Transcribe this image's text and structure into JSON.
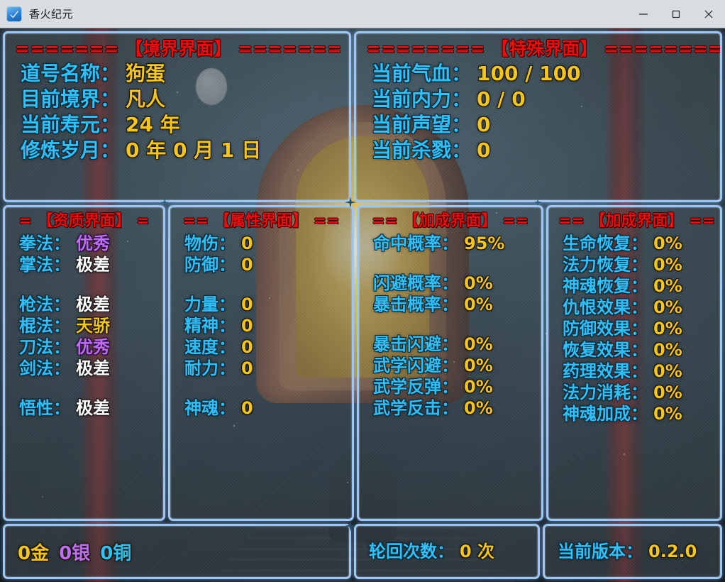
{
  "window": {
    "title": "香火纪元",
    "icon": "app-checkmark-icon",
    "controls": {
      "minimize": "—",
      "maximize": "▢",
      "close": "✕"
    }
  },
  "colors": {
    "panel_border": "#9dc6f5",
    "title_red": "#f00a0a",
    "label_cyan": "#2fc0f7",
    "value_gold": "#f2c51f",
    "value_white": "#ffffff",
    "value_purple": "#bb6ff0"
  },
  "panels": {
    "realm": {
      "title_left": "=======",
      "title_text": "【境界界面】",
      "title_right": "=======",
      "rows": [
        {
          "label": "道号名称：",
          "value": "狗蛋",
          "color": "gold"
        },
        {
          "label": "目前境界：",
          "value": "凡人",
          "color": "gold"
        },
        {
          "label": "当前寿元：",
          "value": "24 年",
          "color": "gold"
        },
        {
          "label": "修炼岁月：",
          "value": "0 年 0 月 1 日",
          "color": "gold"
        }
      ]
    },
    "special": {
      "title_left": "========",
      "title_text": "【特殊界面】",
      "title_right": "========",
      "rows": [
        {
          "label": "当前气血：",
          "value": "100 / 100",
          "color": "gold"
        },
        {
          "label": "当前内力：",
          "value": "0 / 0",
          "color": "gold"
        },
        {
          "label": "当前声望：",
          "value": "0",
          "color": "gold"
        },
        {
          "label": "当前杀戮：",
          "value": "0",
          "color": "gold"
        }
      ]
    },
    "aptitude": {
      "title_left": "=",
      "title_text": "【资质界面】",
      "title_right": "=",
      "rows": [
        {
          "label": "拳法：",
          "value": "优秀",
          "color": "purple",
          "gap": "none"
        },
        {
          "label": "掌法：",
          "value": "极差",
          "color": "white",
          "gap": "none"
        },
        {
          "label": "枪法：",
          "value": "极差",
          "color": "white",
          "gap": "big"
        },
        {
          "label": "棍法：",
          "value": "天骄",
          "color": "gold",
          "gap": "none"
        },
        {
          "label": "刀法：",
          "value": "优秀",
          "color": "purple",
          "gap": "none"
        },
        {
          "label": "剑法：",
          "value": "极差",
          "color": "white",
          "gap": "none"
        },
        {
          "label": "悟性：",
          "value": "极差",
          "color": "white",
          "gap": "big"
        }
      ]
    },
    "attributes": {
      "title_left": "==",
      "title_text": "【属性界面】",
      "title_right": "==",
      "rows": [
        {
          "label": "物伤：",
          "value": "0",
          "color": "gold",
          "gap": "none"
        },
        {
          "label": "防御：",
          "value": "0",
          "color": "gold",
          "gap": "none"
        },
        {
          "label": "力量：",
          "value": "0",
          "color": "gold",
          "gap": "big"
        },
        {
          "label": "精神：",
          "value": "0",
          "color": "gold",
          "gap": "none"
        },
        {
          "label": "速度：",
          "value": "0",
          "color": "gold",
          "gap": "none"
        },
        {
          "label": "耐力：",
          "value": "0",
          "color": "gold",
          "gap": "none"
        },
        {
          "label": "神魂：",
          "value": "0",
          "color": "gold",
          "gap": "big"
        }
      ]
    },
    "bonus_left": {
      "title_left": "==",
      "title_text": "【加成界面】",
      "title_right": "==",
      "rows": [
        {
          "label": "命中概率：",
          "value": "95%",
          "color": "gold",
          "gap": "none"
        },
        {
          "label": "闪避概率：",
          "value": "0%",
          "color": "gold",
          "gap": "big"
        },
        {
          "label": "暴击概率：",
          "value": "0%",
          "color": "gold",
          "gap": "none"
        },
        {
          "label": "暴击闪避：",
          "value": "0%",
          "color": "gold",
          "gap": "big"
        },
        {
          "label": "武学闪避：",
          "value": "0%",
          "color": "gold",
          "gap": "none"
        },
        {
          "label": "武学反弹：",
          "value": "0%",
          "color": "gold",
          "gap": "none"
        },
        {
          "label": "武学反击：",
          "value": "0%",
          "color": "gold",
          "gap": "none"
        }
      ]
    },
    "bonus_right": {
      "title_left": "==",
      "title_text": "【加成界面】",
      "title_right": "==",
      "rows": [
        {
          "label": "生命恢复：",
          "value": "0%",
          "color": "gold",
          "gap": "none"
        },
        {
          "label": "法力恢复：",
          "value": "0%",
          "color": "gold",
          "gap": "none"
        },
        {
          "label": "神魂恢复：",
          "value": "0%",
          "color": "gold",
          "gap": "none"
        },
        {
          "label": "仇恨效果：",
          "value": "0%",
          "color": "gold",
          "gap": "none"
        },
        {
          "label": "防御效果：",
          "value": "0%",
          "color": "gold",
          "gap": "none"
        },
        {
          "label": "恢复效果：",
          "value": "0%",
          "color": "gold",
          "gap": "none"
        },
        {
          "label": "药理效果：",
          "value": "0%",
          "color": "gold",
          "gap": "none"
        },
        {
          "label": "法力消耗：",
          "value": "0%",
          "color": "gold",
          "gap": "none"
        },
        {
          "label": "神魂加成：",
          "value": "0%",
          "color": "gold",
          "gap": "none"
        }
      ]
    },
    "money": {
      "gold": "0金",
      "silver": "0银",
      "copper": "0铜"
    },
    "cycle": {
      "label": "轮回次数：",
      "value": "0 次"
    },
    "version": {
      "label": "当前版本：",
      "value": "0.2.0"
    }
  }
}
